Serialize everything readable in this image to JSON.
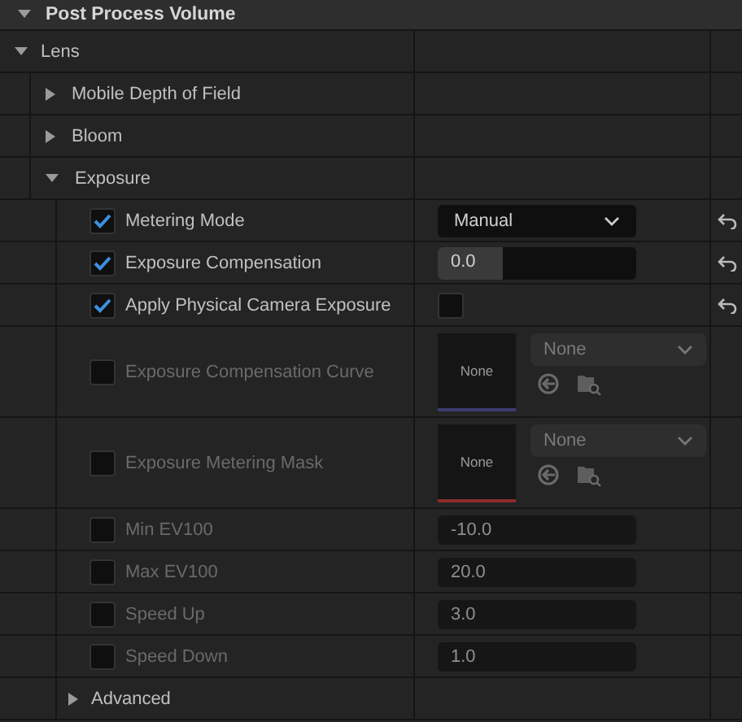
{
  "header": {
    "title": "Post Process Volume",
    "expanded": true
  },
  "categories": [
    {
      "label": "Lens",
      "expanded": true,
      "children": [
        {
          "label": "Mobile Depth of Field",
          "expanded": false
        },
        {
          "label": "Bloom",
          "expanded": false
        },
        {
          "label": "Exposure",
          "expanded": true,
          "properties": [
            {
              "kind": "dropdown",
              "label": "Metering Mode",
              "override": true,
              "value": "Manual"
            },
            {
              "kind": "slider",
              "label": "Exposure Compensation",
              "override": true,
              "value": "0.0",
              "level": 0.33
            },
            {
              "kind": "checkbox",
              "label": "Apply Physical Camera Exposure",
              "override": true,
              "checked": false
            },
            {
              "kind": "asset",
              "label": "Exposure Compensation Curve",
              "override": false,
              "thumbnail": "None",
              "value": "None",
              "color": "#3c3a6e"
            },
            {
              "kind": "asset",
              "label": "Exposure Metering Mask",
              "override": false,
              "thumbnail": "None",
              "value": "None",
              "color": "#8a2c2c"
            },
            {
              "kind": "number",
              "label": "Min EV100",
              "override": false,
              "value": "-10.0"
            },
            {
              "kind": "number",
              "label": "Max EV100",
              "override": false,
              "value": "20.0"
            },
            {
              "kind": "number",
              "label": "Speed Up",
              "override": false,
              "value": "3.0"
            },
            {
              "kind": "number",
              "label": "Speed Down",
              "override": false,
              "value": "1.0"
            },
            {
              "kind": "group",
              "label": "Advanced",
              "expanded": false
            }
          ]
        }
      ]
    }
  ]
}
